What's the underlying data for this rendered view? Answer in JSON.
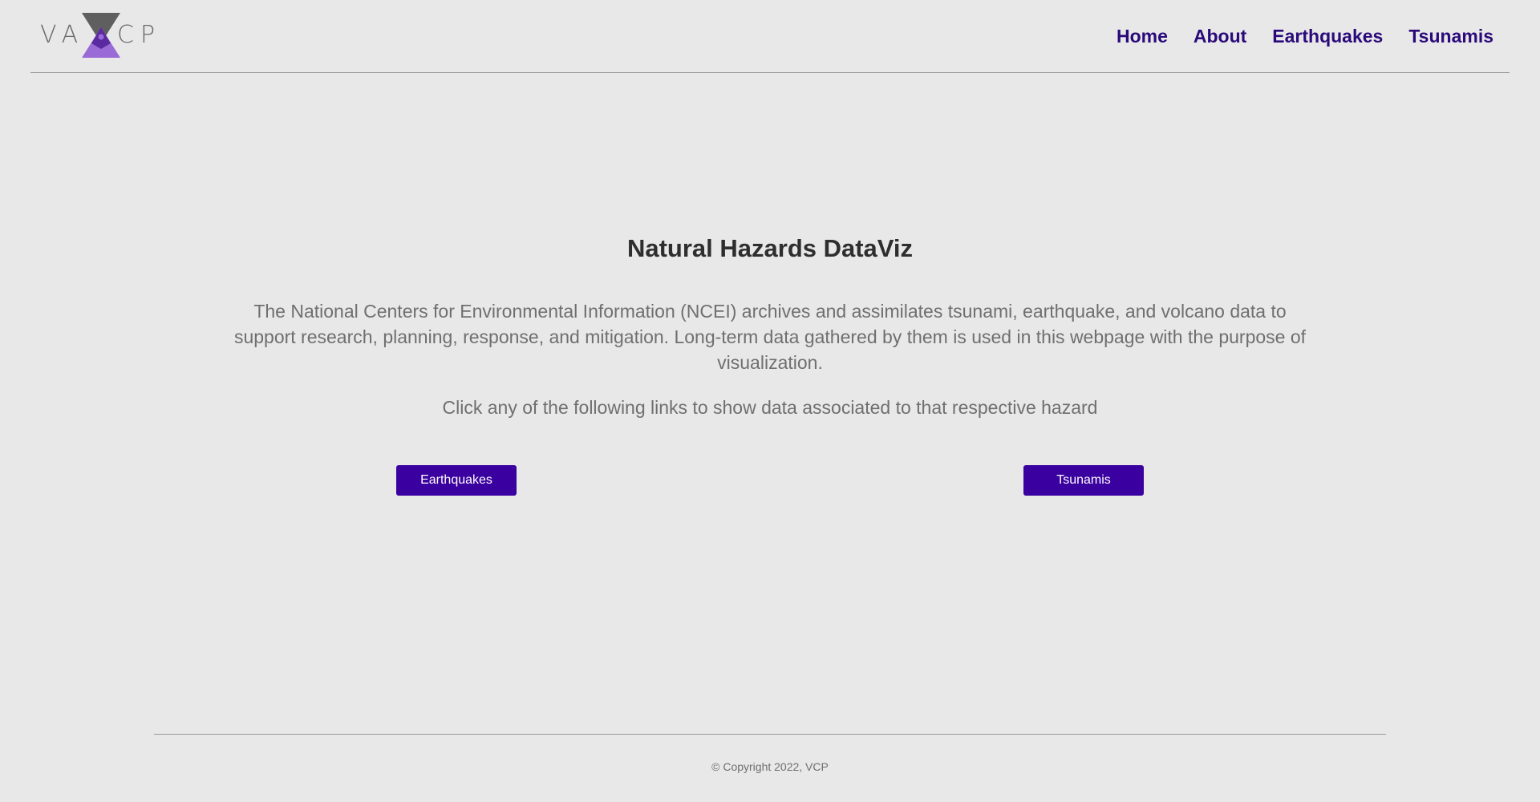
{
  "logo": {
    "left_text": "VA",
    "right_text": "CP",
    "icon": "hourglass-triangle-logo-icon",
    "colors": {
      "top": "#5f5f5f",
      "bottom": "#9a6ad6",
      "inner": "#5a2aa0"
    }
  },
  "nav": {
    "items": [
      {
        "label": "Home"
      },
      {
        "label": "About"
      },
      {
        "label": "Earthquakes"
      },
      {
        "label": "Tsunamis"
      }
    ],
    "color": "#2a0a7a"
  },
  "main": {
    "title": "Natural Hazards DataViz",
    "description": "The National Centers for Environmental Information (NCEI) archives and assimilates tsunami, earthquake, and volcano data to support research, planning, response, and mitigation. Long-term data gathered by them is used in this webpage with the purpose of visualization.",
    "cta": "Click any of the following links to show data associated to that respective hazard",
    "buttons": {
      "earthquakes": "Earthquakes",
      "tsunamis": "Tsunamis"
    },
    "button_color": "#3a00a0"
  },
  "footer": {
    "copyright": "© Copyright 2022, VCP"
  }
}
